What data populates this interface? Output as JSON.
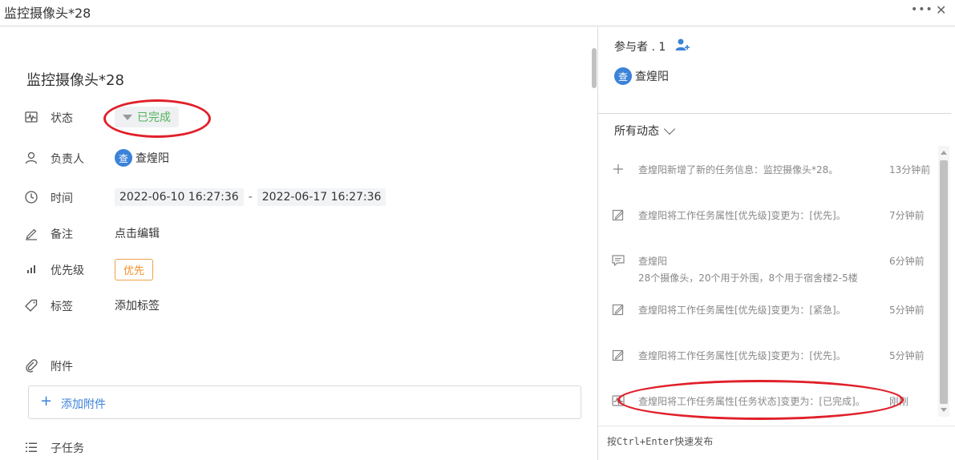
{
  "window": {
    "title": "监控摄像头*28",
    "more_label": "•••",
    "close_label": "✕"
  },
  "task": {
    "title": "监控摄像头*28",
    "fields": {
      "status": {
        "label": "状态",
        "value": "已完成"
      },
      "assignee": {
        "label": "负责人",
        "avatar": "查",
        "name": "查煌阳"
      },
      "time": {
        "label": "时间",
        "start": "2022-06-10 16:27:36",
        "end": "2022-06-17 16:27:36",
        "sep": "-"
      },
      "note": {
        "label": "备注",
        "value": "点击编辑"
      },
      "priority": {
        "label": "优先级",
        "value": "优先"
      },
      "tags": {
        "label": "标签",
        "value": "添加标签"
      },
      "attachments": {
        "label": "附件",
        "add_label": "添加附件"
      },
      "subtasks": {
        "label": "子任务"
      }
    }
  },
  "participants": {
    "label": "参与者 . 1",
    "user_avatar": "查",
    "user_name": "查煌阳"
  },
  "activity": {
    "header": "所有动态",
    "items": [
      {
        "icon": "plus-icon",
        "text": "查煌阳新增了新的任务信息：监控摄像头*28。",
        "time": "13分钟前"
      },
      {
        "icon": "edit-icon",
        "text": "查煌阳将工作任务属性[优先级]变更为：[优先]。",
        "time": "7分钟前"
      },
      {
        "icon": "comment-icon",
        "text": "查煌阳",
        "sub": "28个摄像头，20个用于外围，8个用于宿舍楼2-5楼",
        "time": "6分钟前"
      },
      {
        "icon": "edit-icon",
        "text": "查煌阳将工作任务属性[优先级]变更为：[紧急]。",
        "time": "5分钟前"
      },
      {
        "icon": "edit-icon",
        "text": "查煌阳将工作任务属性[优先级]变更为：[优先]。",
        "time": "5分钟前"
      },
      {
        "icon": "status-icon",
        "text": "查煌阳将工作任务属性[任务状态]变更为：[已完成]。",
        "time": "刚刚"
      }
    ]
  },
  "compose": {
    "hint": "按Ctrl+Enter快速发布"
  },
  "colors": {
    "accent": "#3b82d8",
    "status_done": "#52b35a",
    "priority": "#f0902a",
    "annotation": "#e0202a"
  }
}
